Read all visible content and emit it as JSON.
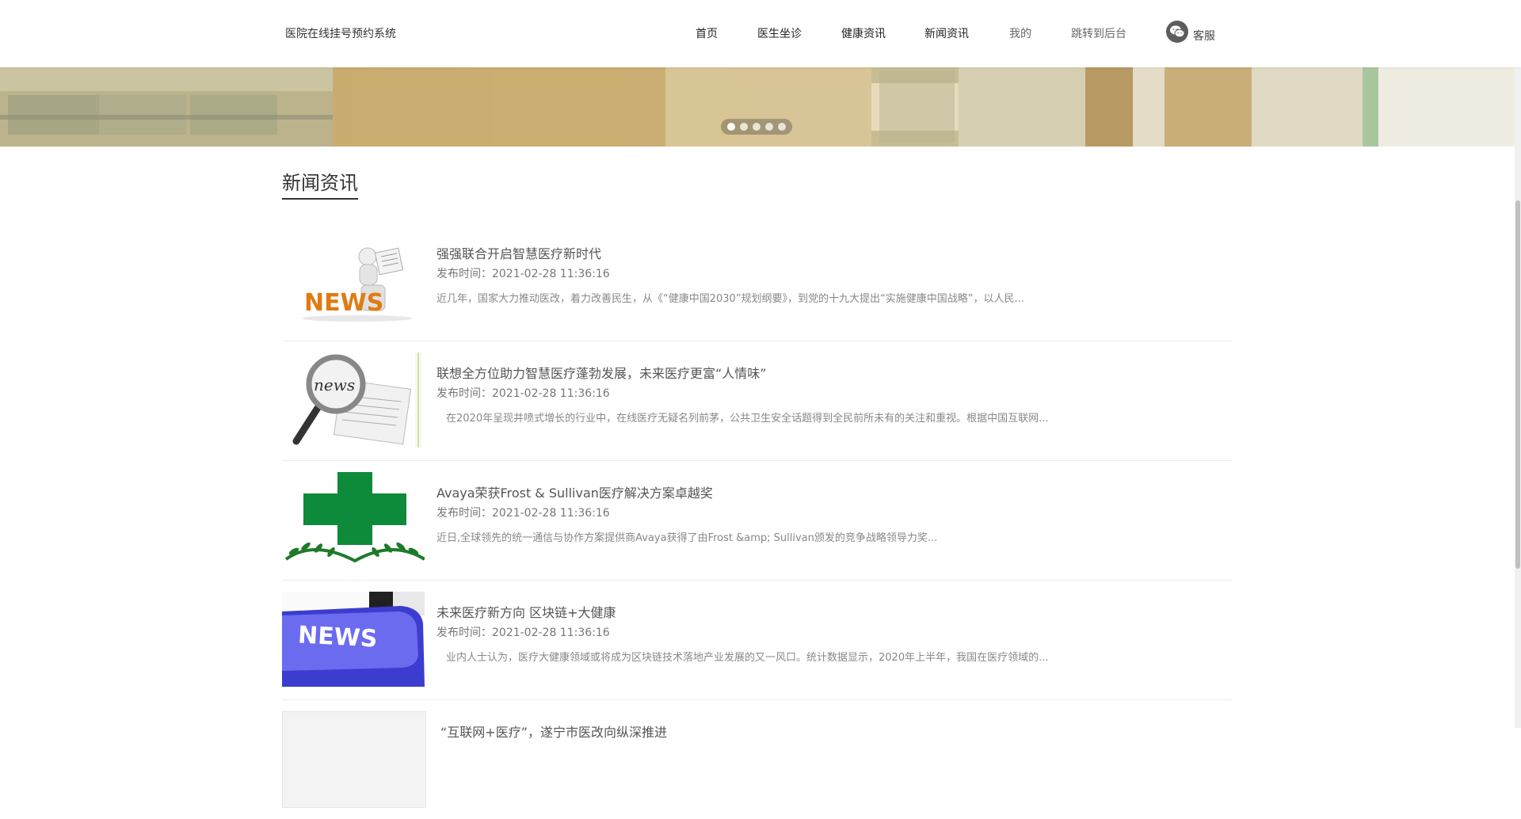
{
  "header": {
    "brand": "医院在线挂号预约系统",
    "nav": [
      "首页",
      "医生坐诊",
      "健康资讯",
      "新闻资讯",
      "我的",
      "跳转到后台"
    ],
    "customer_service": "客服"
  },
  "banner": {
    "active_slide": 1,
    "slide_count": 5
  },
  "section": {
    "title": "新闻资讯"
  },
  "news": [
    {
      "title": "强强联合开启智慧医疗新时代",
      "date": "发布时间：2021-02-28 11:36:16",
      "summary": "近几年，国家大力推动医改，着力改善民生，从《“健康中国2030”规划纲要》，到党的十九大提出“实施健康中国战略”，以人民...",
      "image_text": "NEWS"
    },
    {
      "title": "联想全方位助力智慧医疗蓬勃发展，未来医疗更富“人情味”",
      "date": "发布时间：2021-02-28 11:36:16",
      "summary": "在2020年呈现井喷式增长的行业中，在线医疗无疑名列前茅，公共卫生安全话题得到全民前所未有的关注和重视。根据中国互联网...",
      "image_text": "news"
    },
    {
      "title": "Avaya荣获Frost & Sullivan医疗解决方案卓越奖",
      "date": "发布时间：2021-02-28 11:36:16",
      "summary": "近日,全球领先的统一通信与协作方案提供商Avaya获得了由Frost &amp; Sullivan颁发的竞争战略领导力奖...",
      "image_text": ""
    },
    {
      "title": "未来医疗新方向 区块链+大健康",
      "date": "发布时间：2021-02-28 11:36:16",
      "summary": "业内人士认为，医疗大健康领域或将成为区块链技术落地产业发展的又一风口。统计数据显示，2020年上半年，我国在医疗领域的...",
      "image_text": "NEWS"
    },
    {
      "title": "“互联网+医疗”，遂宁市医改向纵深推进",
      "date": "",
      "summary": "",
      "image_text": ""
    }
  ]
}
